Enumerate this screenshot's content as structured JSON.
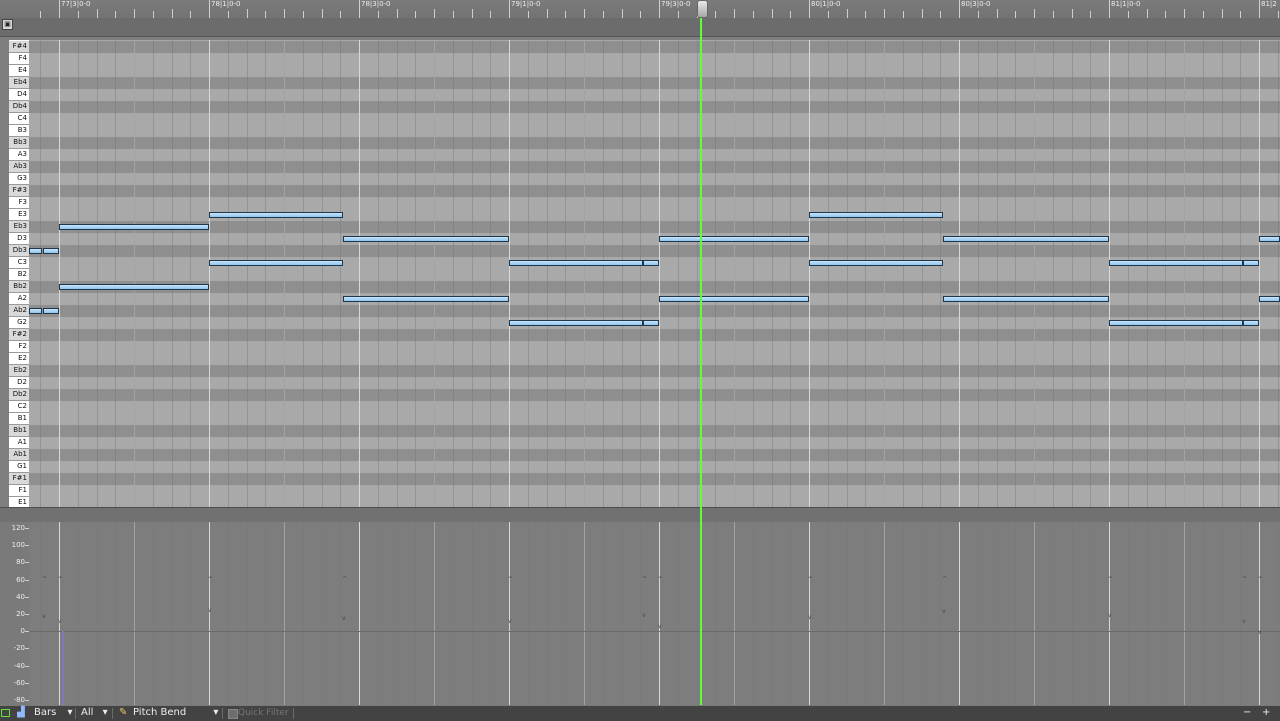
{
  "ruler": {
    "bar_labels": [
      "77|3|0-0",
      "78|1|0-0",
      "78|3|0-0",
      "79|1|0-0",
      "79|3|0-0",
      "80|1|0-0",
      "80|3|0-0",
      "81|1|0-0",
      "81|2"
    ]
  },
  "piano_roll": {
    "keys": [
      {
        "label": "F#4",
        "black": true
      },
      {
        "label": "F4",
        "black": false
      },
      {
        "label": "E4",
        "black": false
      },
      {
        "label": "Eb4",
        "black": true
      },
      {
        "label": "D4",
        "black": false
      },
      {
        "label": "Db4",
        "black": true
      },
      {
        "label": "C4",
        "black": false
      },
      {
        "label": "B3",
        "black": false
      },
      {
        "label": "Bb3",
        "black": true
      },
      {
        "label": "A3",
        "black": false
      },
      {
        "label": "Ab3",
        "black": true
      },
      {
        "label": "G3",
        "black": false
      },
      {
        "label": "F#3",
        "black": true
      },
      {
        "label": "F3",
        "black": false
      },
      {
        "label": "E3",
        "black": false
      },
      {
        "label": "Eb3",
        "black": true
      },
      {
        "label": "D3",
        "black": false
      },
      {
        "label": "Db3",
        "black": true
      },
      {
        "label": "C3",
        "black": false
      },
      {
        "label": "B2",
        "black": false
      },
      {
        "label": "Bb2",
        "black": true
      },
      {
        "label": "A2",
        "black": false
      },
      {
        "label": "Ab2",
        "black": true
      },
      {
        "label": "G2",
        "black": false
      },
      {
        "label": "F#2",
        "black": true
      },
      {
        "label": "F2",
        "black": false
      },
      {
        "label": "E2",
        "black": false
      },
      {
        "label": "Eb2",
        "black": true
      },
      {
        "label": "D2",
        "black": false
      },
      {
        "label": "Db2",
        "black": true
      },
      {
        "label": "C2",
        "black": false
      },
      {
        "label": "B1",
        "black": false
      },
      {
        "label": "Bb1",
        "black": true
      },
      {
        "label": "A1",
        "black": false
      },
      {
        "label": "Ab1",
        "black": true
      },
      {
        "label": "G1",
        "black": false
      },
      {
        "label": "F#1",
        "black": true
      },
      {
        "label": "F1",
        "black": false
      },
      {
        "label": "E1",
        "black": false
      }
    ],
    "colors": {
      "note_fill": "#a9d5f5",
      "note_border": "#22364a",
      "playhead": "#5bff3a"
    }
  },
  "velocity_lane": {
    "scale_labels": [
      "120",
      "100",
      "80",
      "60",
      "40",
      "20",
      "0",
      "-20",
      "-40",
      "-60",
      "-80"
    ]
  },
  "toolbar": {
    "grid_unit": "Bars",
    "filter_all": "All",
    "controller": "Pitch Bend",
    "quick_filter_placeholder": "Quick Filter",
    "zoom_out_label": "−",
    "zoom_in_label": "+"
  }
}
